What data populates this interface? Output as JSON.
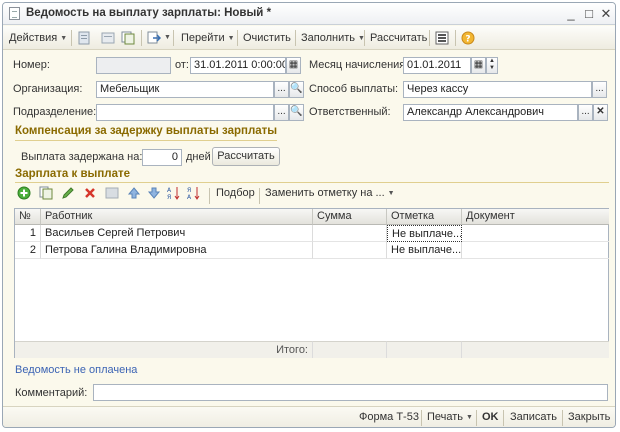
{
  "window": {
    "title": "Ведомость на выплату зарплаты: Новый *"
  },
  "toolbar": {
    "actions": "Действия",
    "goto": "Перейти",
    "clear": "Очистить",
    "fill": "Заполнить",
    "calculate": "Рассчитать"
  },
  "form": {
    "number_label": "Номер:",
    "number_value": "",
    "from_label": "от:",
    "date_value": "31.01.2011  0:00:00",
    "org_label": "Организация:",
    "org_value": "Мебельщик",
    "dept_label": "Подразделение:",
    "dept_value": "",
    "month_label": "Месяц начисления:",
    "month_value": "01.01.2011",
    "method_label": "Способ выплаты:",
    "method_value": "Через кассу",
    "resp_label": "Ответственный:",
    "resp_value": "Александр Александрович"
  },
  "compensation": {
    "title": "Компенсация за задержку выплаты зарплаты",
    "delay_label": "Выплата задержана на:",
    "delay_value": "0",
    "days_label": "дней",
    "calc_button": "Рассчитать"
  },
  "salary": {
    "title": "Зарплата к выплате",
    "pick_button": "Подбор",
    "replace_mark": "Заменить отметку на ..."
  },
  "table": {
    "columns": [
      "№",
      "Работник",
      "Сумма",
      "Отметка",
      "Документ"
    ],
    "rows": [
      {
        "num": "1",
        "employee": "Васильев Сергей Петрович",
        "amount": "",
        "mark": "Не выплаче...",
        "document": ""
      },
      {
        "num": "2",
        "employee": "Петрова Галина Владимировна",
        "amount": "",
        "mark": "Не выплаче...",
        "document": ""
      }
    ],
    "total_label": "Итого:"
  },
  "status_link": "Ведомость не оплачена",
  "comment": {
    "label": "Комментарий:",
    "value": ""
  },
  "bottom": {
    "form_t53": "Форма Т-53",
    "print": "Печать",
    "ok": "OK",
    "save": "Записать",
    "close": "Закрыть"
  },
  "colors": {
    "section_title": "#8a6a00",
    "link": "#3c64b4",
    "window_bg": "#fbf9ec"
  }
}
